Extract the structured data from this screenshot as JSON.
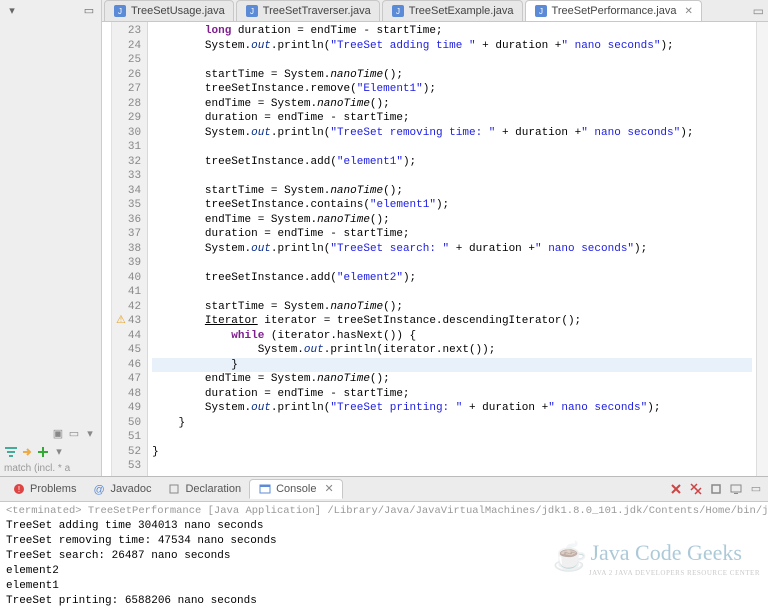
{
  "tabs": [
    {
      "label": "TreeSetUsage.java",
      "active": false
    },
    {
      "label": "TreeSetTraverser.java",
      "active": false
    },
    {
      "label": "TreeSetExample.java",
      "active": false
    },
    {
      "label": "TreeSetPerformance.java",
      "active": true
    }
  ],
  "gutter_start": 23,
  "code_lines": [
    {
      "n": 23,
      "html": "        <span class='kw'>long</span> duration = endTime - startTime;"
    },
    {
      "n": 24,
      "html": "        System.<span class='fld'>out</span>.println(<span class='str'>\"TreeSet adding time \"</span> + duration +<span class='str'>\" nano seconds\"</span>);"
    },
    {
      "n": 25,
      "html": ""
    },
    {
      "n": 26,
      "html": "        startTime = System.<span class='mth'>nanoTime</span>();"
    },
    {
      "n": 27,
      "html": "        treeSetInstance.remove(<span class='str'>\"Element1\"</span>);"
    },
    {
      "n": 28,
      "html": "        endTime = System.<span class='mth'>nanoTime</span>();"
    },
    {
      "n": 29,
      "html": "        duration = endTime - startTime;"
    },
    {
      "n": 30,
      "html": "        System.<span class='fld'>out</span>.println(<span class='str'>\"TreeSet removing time: \"</span> + duration +<span class='str'>\" nano seconds\"</span>);"
    },
    {
      "n": 31,
      "html": ""
    },
    {
      "n": 32,
      "html": "        treeSetInstance.add(<span class='str'>\"element1\"</span>);"
    },
    {
      "n": 33,
      "html": ""
    },
    {
      "n": 34,
      "html": "        startTime = System.<span class='mth'>nanoTime</span>();"
    },
    {
      "n": 35,
      "html": "        treeSetInstance.contains(<span class='str'>\"element1\"</span>);"
    },
    {
      "n": 36,
      "html": "        endTime = System.<span class='mth'>nanoTime</span>();"
    },
    {
      "n": 37,
      "html": "        duration = endTime - startTime;"
    },
    {
      "n": 38,
      "html": "        System.<span class='fld'>out</span>.println(<span class='str'>\"TreeSet search: \"</span> + duration +<span class='str'>\" nano seconds\"</span>);"
    },
    {
      "n": 39,
      "html": ""
    },
    {
      "n": 40,
      "html": "        treeSetInstance.add(<span class='str'>\"element2\"</span>);"
    },
    {
      "n": 41,
      "html": ""
    },
    {
      "n": 42,
      "html": "        startTime = System.<span class='mth'>nanoTime</span>();"
    },
    {
      "n": 43,
      "html": "        <u>Iterator</u> iterator = treeSetInstance.descendingIterator();",
      "warn": true
    },
    {
      "n": 44,
      "html": "            <span class='kw'>while</span> (iterator.hasNext()) {"
    },
    {
      "n": 45,
      "html": "                System.<span class='fld'>out</span>.println(iterator.next());"
    },
    {
      "n": 46,
      "html": "            }",
      "hl": true
    },
    {
      "n": 47,
      "html": "        endTime = System.<span class='mth'>nanoTime</span>();"
    },
    {
      "n": 48,
      "html": "        duration = endTime - startTime;"
    },
    {
      "n": 49,
      "html": "        System.<span class='fld'>out</span>.println(<span class='str'>\"TreeSet printing: \"</span> + duration +<span class='str'>\" nano seconds\"</span>);"
    },
    {
      "n": 50,
      "html": "    }"
    },
    {
      "n": 51,
      "html": ""
    },
    {
      "n": 52,
      "html": "}"
    },
    {
      "n": 53,
      "html": ""
    }
  ],
  "bottom_tabs": [
    {
      "label": "Problems"
    },
    {
      "label": "Javadoc"
    },
    {
      "label": "Declaration"
    },
    {
      "label": "Console",
      "active": true
    }
  ],
  "console": {
    "header": "<terminated> TreeSetPerformance [Java Application] /Library/Java/JavaVirtualMachines/jdk1.8.0_101.jdk/Contents/Home/bin/java (Mar",
    "lines": [
      "TreeSet adding time 304013 nano seconds",
      "TreeSet removing time: 47534 nano seconds",
      "TreeSet search: 26487 nano seconds",
      "element2",
      "element1",
      "TreeSet printing: 6588206 nano seconds"
    ]
  },
  "left": {
    "match": "match (incl. * a"
  },
  "watermark": {
    "title": "Java Code Geeks",
    "subtitle": "JAVA 2 JAVA DEVELOPERS RESOURCE CENTER"
  }
}
